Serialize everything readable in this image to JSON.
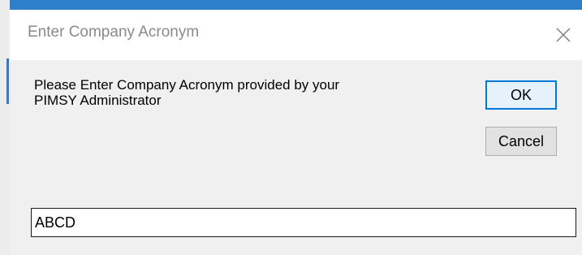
{
  "dialog": {
    "title": "Enter Company Acronym",
    "message_line1": "Please Enter Company Acronym provided by your",
    "message_line2": "PIMSY Administrator",
    "ok_label": "OK",
    "cancel_label": "Cancel",
    "input_value": "ABCD",
    "close_icon": "close-icon"
  },
  "colors": {
    "accent": "#0078d7",
    "window_background": "#f0f0f0",
    "titlebar_background": "#ffffff",
    "title_text": "#8a8a8a"
  }
}
